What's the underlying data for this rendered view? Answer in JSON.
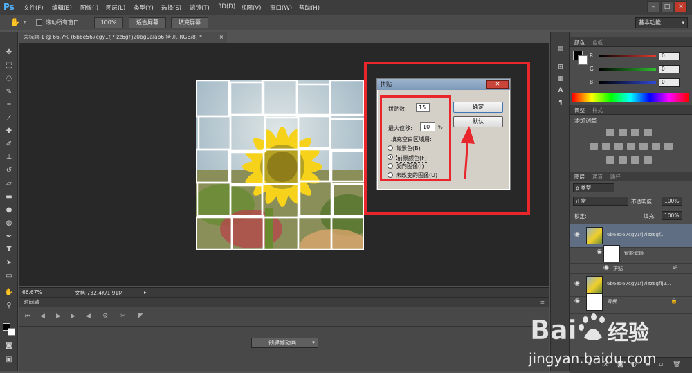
{
  "app": {
    "logo": "Ps"
  },
  "menu": [
    "文件(F)",
    "编辑(E)",
    "图像(I)",
    "图层(L)",
    "类型(Y)",
    "选择(S)",
    "滤镜(T)",
    "3D(D)",
    "视图(V)",
    "窗口(W)",
    "帮助(H)"
  ],
  "options": {
    "scroll_all_label": "滚动所有窗口",
    "zoom_100": "100%",
    "fit_screen": "适合屏幕",
    "fill_screen": "填充屏幕",
    "workspace": "基本功能"
  },
  "document": {
    "tab_title": "未标题-1 @ 66.7% (6b6e567cgy1fj7izz6gflj20bg0alab6 拷贝, RGB/8) *",
    "zoom": "66.67%",
    "doc_info": "文档:732.4K/1.91M"
  },
  "timeline": {
    "title": "时间轴",
    "create_button": "创建帧动画"
  },
  "color_panel": {
    "tabs": [
      "颜色",
      "色板"
    ],
    "channels": [
      {
        "label": "R",
        "value": "0",
        "color": "#e53b2f"
      },
      {
        "label": "G",
        "value": "0",
        "color": "#2fc030"
      },
      {
        "label": "B",
        "value": "0",
        "color": "#3048d8"
      }
    ]
  },
  "adjust_panel": {
    "tabs": [
      "调整",
      "样式"
    ],
    "heading": "添加调整"
  },
  "layers_panel": {
    "tabs": [
      "图层",
      "通道",
      "路径"
    ],
    "filter_kind": "ρ 类型",
    "blend_mode": "正常",
    "opacity_label": "不透明度:",
    "opacity_value": "100%",
    "lock_label": "锁定:",
    "fill_label": "填充:",
    "fill_value": "100%",
    "layers": [
      {
        "name": "6b6e567cgy1fj7izz6gf...",
        "type": "smart"
      },
      {
        "name": "智能滤镜",
        "type": "filter-mask"
      },
      {
        "name": "拼贴",
        "type": "filter"
      },
      {
        "name": "6b6e567cgy1fj7izz6gflj2...",
        "type": "image"
      },
      {
        "name": "背景",
        "type": "background"
      }
    ]
  },
  "dialog": {
    "title": "拼贴",
    "tiles_label": "拼贴数:",
    "tiles_value": "15",
    "offset_label": "最大位移:",
    "offset_value": "10",
    "offset_unit": "%",
    "group_label": "填充空白区域用:",
    "options": [
      {
        "label": "背景色(B)",
        "selected": false
      },
      {
        "label": "前景颜色(F)",
        "selected": true
      },
      {
        "label": "反向图像(I)",
        "selected": false
      },
      {
        "label": "未改变的图像(U)",
        "selected": false
      }
    ],
    "ok_button": "确定",
    "default_button": "默认"
  },
  "watermark": {
    "brand": "Bai",
    "brand2": "经验",
    "url": "jingyan.baidu.com"
  }
}
